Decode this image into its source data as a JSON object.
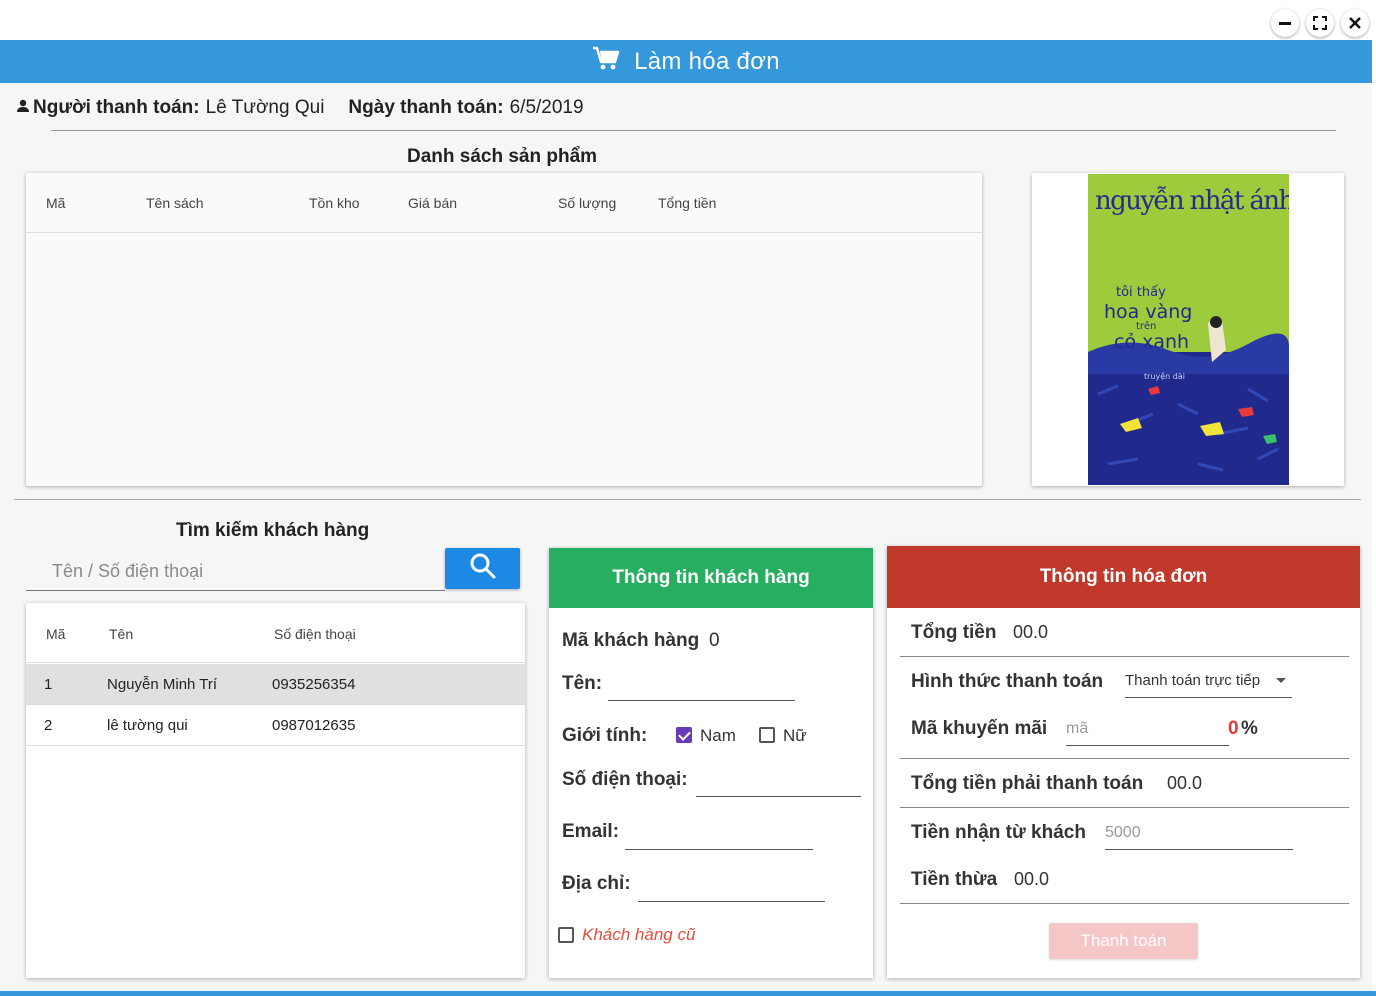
{
  "window": {
    "controls": {
      "minimize_icon": "minimize-icon",
      "maximize_icon": "fullscreen-icon",
      "close_icon": "close-icon"
    }
  },
  "header": {
    "title": "Làm hóa đơn",
    "icon": "cart-icon",
    "color": "#3498db"
  },
  "payer": {
    "label": "Người thanh toán:",
    "name": "Lê Tường Qui",
    "date_label": "Ngày thanh toán:",
    "date": "6/5/2019"
  },
  "products": {
    "title": "Danh sách sản phẩm",
    "columns": [
      "Mã",
      "Tên sách",
      "Tồn kho",
      "Giá bán",
      "Số lượng",
      "Tổng tiền"
    ],
    "rows": []
  },
  "book_cover": {
    "author": "nguyễn nhật ánh",
    "line1": "tôi thấy",
    "line2": "hoa vàng",
    "line3": "trên",
    "line4": "cỏ xanh",
    "subtitle": "truyện dài"
  },
  "customer_search": {
    "title": "Tìm kiếm khách hàng",
    "placeholder": "Tên / Số điện thoại",
    "button_icon": "search-icon",
    "columns": [
      "Mã",
      "Tên",
      "Số điện thoại"
    ],
    "rows": [
      {
        "id": "1",
        "name": "Nguyễn Minh Trí",
        "phone": "0935256354"
      },
      {
        "id": "2",
        "name": "lê tường qui",
        "phone": "0987012635"
      }
    ]
  },
  "customer_info": {
    "title": "Thông tin khách hàng",
    "color": "#27ae60",
    "id_label": "Mã khách hàng",
    "id_value": "0",
    "name_label": "Tên:",
    "gender_label": "Giới tính:",
    "gender_male": "Nam",
    "gender_female": "Nữ",
    "male_checked": true,
    "female_checked": false,
    "phone_label": "Số điện thoại:",
    "email_label": "Email:",
    "address_label": "Địa chỉ:",
    "old_customer_label": "Khách hàng cũ"
  },
  "invoice_info": {
    "title": "Thông tin hóa đơn",
    "color": "#c0392b",
    "total_label": "Tổng tiền",
    "total_value": "00.0",
    "payment_method_label": "Hình thức thanh toán",
    "payment_method_value": "Thanh toán trực tiếp",
    "promo_label": "Mã khuyến mãi",
    "promo_placeholder": "mã",
    "promo_percent": "0",
    "percent_sign": "%",
    "payable_label": "Tổng tiền phải thanh toán",
    "payable_value": "00.0",
    "received_label": "Tiền nhận từ khách",
    "received_placeholder": "5000",
    "change_label": "Tiền thừa",
    "change_value": "00.0",
    "pay_button": "Thanh toán"
  }
}
